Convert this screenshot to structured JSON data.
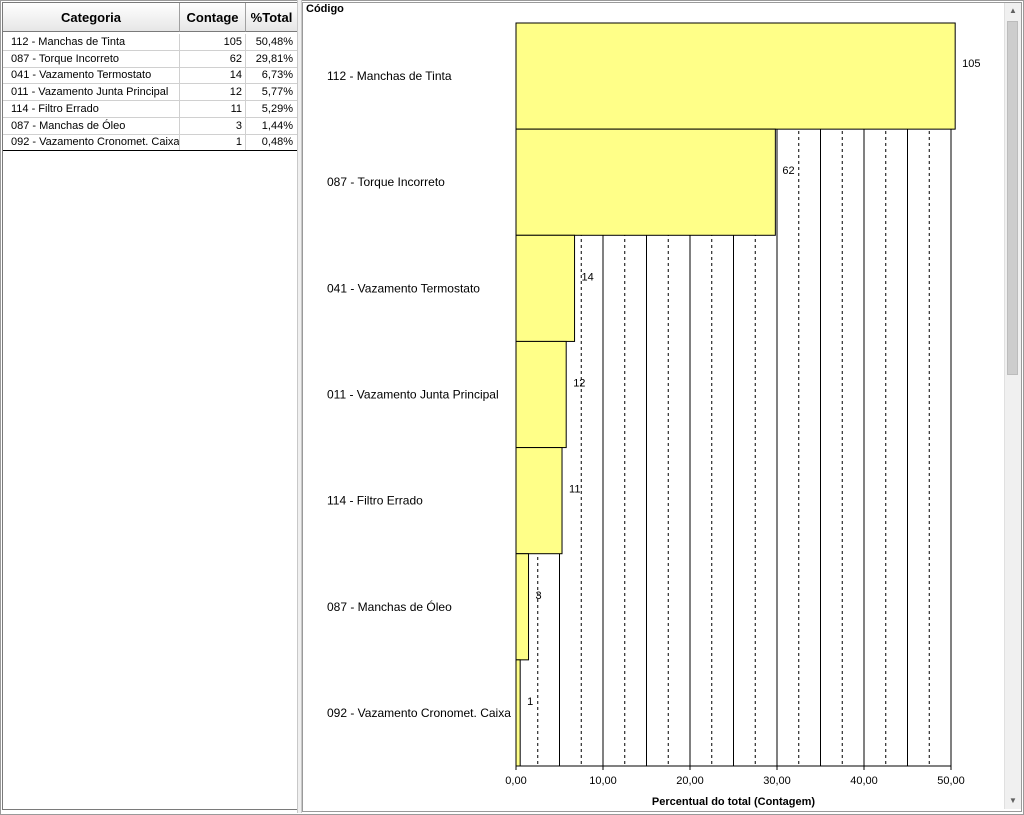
{
  "table": {
    "headers": {
      "category": "Categoria",
      "count": "Contage",
      "pct": "%Total"
    },
    "rows": [
      {
        "category": "112 - Manchas de Tinta",
        "count": "105",
        "pct": "50,48%"
      },
      {
        "category": "087 - Torque Incorreto",
        "count": "62",
        "pct": "29,81%"
      },
      {
        "category": "041 - Vazamento Termostato",
        "count": "14",
        "pct": "6,73%"
      },
      {
        "category": "011 - Vazamento Junta Principal",
        "count": "12",
        "pct": "5,77%"
      },
      {
        "category": "114 - Filtro Errado",
        "count": "11",
        "pct": "5,29%"
      },
      {
        "category": "087 - Manchas de Óleo",
        "count": "3",
        "pct": "1,44%"
      },
      {
        "category": "092 - Vazamento Cronomet. Caixa",
        "count": "1",
        "pct": "0,48%"
      }
    ]
  },
  "chart_data": {
    "type": "bar",
    "orientation": "horizontal",
    "title": "Código",
    "xlabel": "Percentual do total (Contagem)",
    "ylabel": "",
    "categories": [
      "112 - Manchas de Tinta",
      "087 - Torque Incorreto",
      "041 - Vazamento Termostato",
      "011 - Vazamento Junta Principal",
      "114 - Filtro Errado",
      "087 - Manchas de Óleo",
      "092 - Vazamento Cronomet. Caixa"
    ],
    "values": [
      50.48,
      29.81,
      6.73,
      5.77,
      5.29,
      1.44,
      0.48
    ],
    "data_labels": [
      "105",
      "62",
      "14",
      "12",
      "11",
      "3",
      "1"
    ],
    "xlim": [
      0,
      50
    ],
    "xticks": [
      0,
      10,
      20,
      30,
      40,
      50
    ],
    "xtick_labels": [
      "0,00",
      "10,00",
      "20,00",
      "30,00",
      "40,00",
      "50,00"
    ],
    "minor_grid_step": 2.5,
    "grid": true,
    "bar_color": "#ffff88",
    "bar_edge_color": "#000000"
  },
  "colors": {
    "bar_fill": "#ffff88",
    "grid": "#000000"
  },
  "scrollbar": {
    "up_icon": "▲",
    "down_icon": "▼"
  }
}
